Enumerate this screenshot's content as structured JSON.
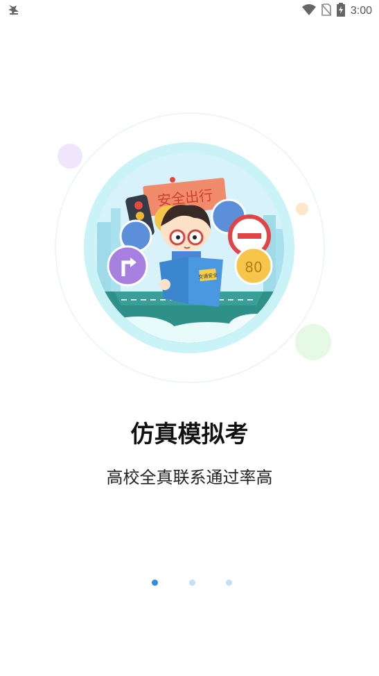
{
  "status_bar": {
    "time": "3:00",
    "icons": [
      "notification-icon",
      "wifi-icon",
      "no-sim-icon",
      "battery-icon"
    ]
  },
  "onboarding": {
    "title": "仿真模拟考",
    "subtitle": "高校全真联系通过率高",
    "illustration": {
      "sign_text": "安全出行",
      "book_text": "交通安全"
    },
    "pager": {
      "total_pages": 3,
      "active_index": 0,
      "active_color": "#2f8de0",
      "inactive_color": "#bfe0fb"
    }
  },
  "colors": {
    "accent": "#2f8de0",
    "circle_outer": "#c9f3f6",
    "circle_inner": "#d7f2fb"
  }
}
